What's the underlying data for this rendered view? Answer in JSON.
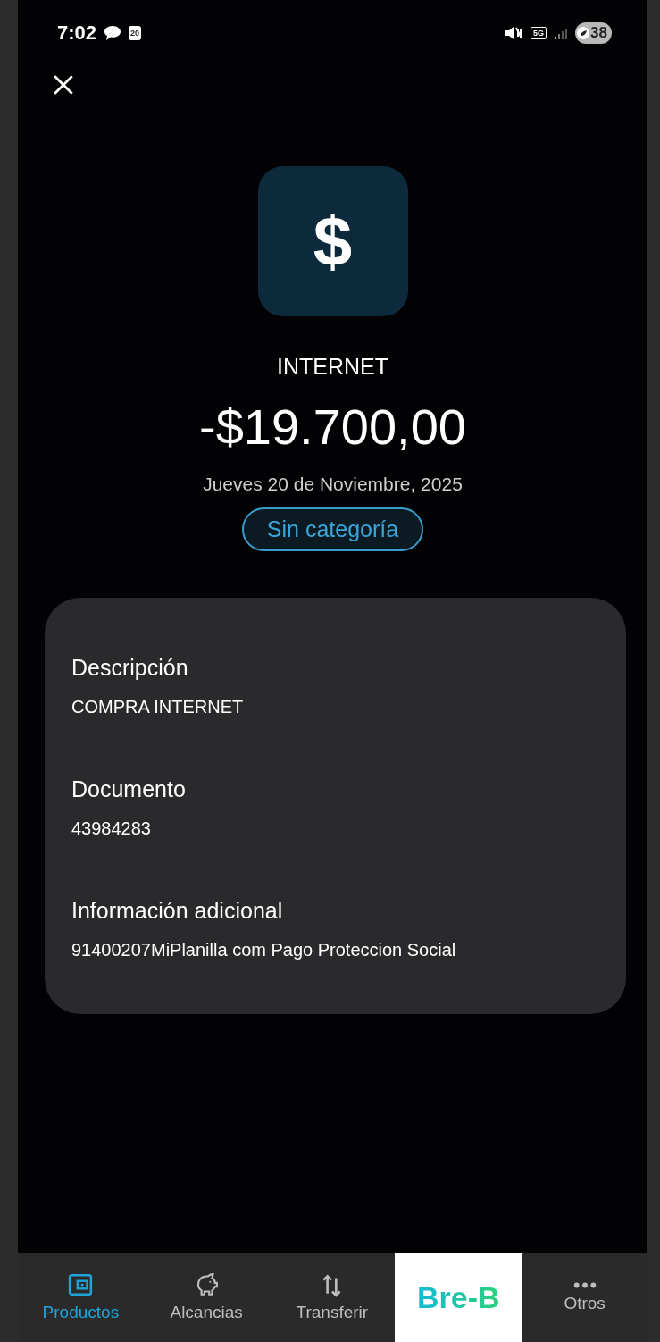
{
  "status_bar": {
    "time": "7:02",
    "calendar_day": "20",
    "network": "5G",
    "battery": "38"
  },
  "transaction": {
    "icon_symbol": "$",
    "merchant": "INTERNET",
    "amount": "-$19.700,00",
    "date": "Jueves 20 de Noviembre, 2025",
    "category": "Sin categoría"
  },
  "details": [
    {
      "label": "Descripción",
      "value": "COMPRA INTERNET"
    },
    {
      "label": "Documento",
      "value": "43984283"
    },
    {
      "label": "Información adicional",
      "value": "91400207MiPlanilla com Pago Proteccion Social"
    }
  ],
  "bottom_nav": [
    {
      "kind": "wallet",
      "label": "Productos",
      "selected": true
    },
    {
      "kind": "piggy",
      "label": "Alcancias",
      "selected": false
    },
    {
      "kind": "transfer",
      "label": "Transferir",
      "selected": false
    },
    {
      "kind": "brand",
      "label": "Bre-B",
      "selected": false
    },
    {
      "kind": "more",
      "label": "Otros",
      "selected": false
    }
  ]
}
